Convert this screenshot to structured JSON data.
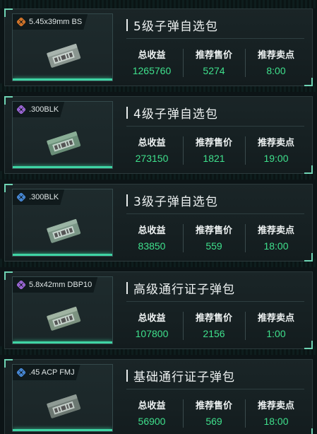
{
  "labels": {
    "total_income": "总收益",
    "recommended_price": "推荐售价",
    "recommended_time": "推荐卖点"
  },
  "cards": [
    {
      "ammo": "5.45x39mm BS",
      "rarity_icon": "orange-diamond-icon",
      "rarity_color": "#e07a2a",
      "title": "5级子弹自选包",
      "total_income": "1265760",
      "price": "5274",
      "time": "8:00"
    },
    {
      "ammo": ".300BLK",
      "rarity_icon": "purple-diamond-icon",
      "rarity_color": "#a46ae0",
      "title": "4级子弹自选包",
      "total_income": "273150",
      "price": "1821",
      "time": "19:00"
    },
    {
      "ammo": ".300BLK",
      "rarity_icon": "blue-diamond-icon",
      "rarity_color": "#4a8ee0",
      "title": "3级子弹自选包",
      "total_income": "83850",
      "price": "559",
      "time": "18:00"
    },
    {
      "ammo": "5.8x42mm DBP10",
      "rarity_icon": "purple-diamond-icon",
      "rarity_color": "#a46ae0",
      "title": "高级通行证子弹包",
      "total_income": "107800",
      "price": "2156",
      "time": "1:00"
    },
    {
      "ammo": ".45 ACP FMJ",
      "rarity_icon": "blue-diamond-icon",
      "rarity_color": "#4a8ee0",
      "title": "基础通行证子弹包",
      "total_income": "56900",
      "price": "569",
      "time": "18:00"
    }
  ],
  "colors": {
    "accent": "#3fd4a4",
    "value_green": "#3fe08c"
  }
}
